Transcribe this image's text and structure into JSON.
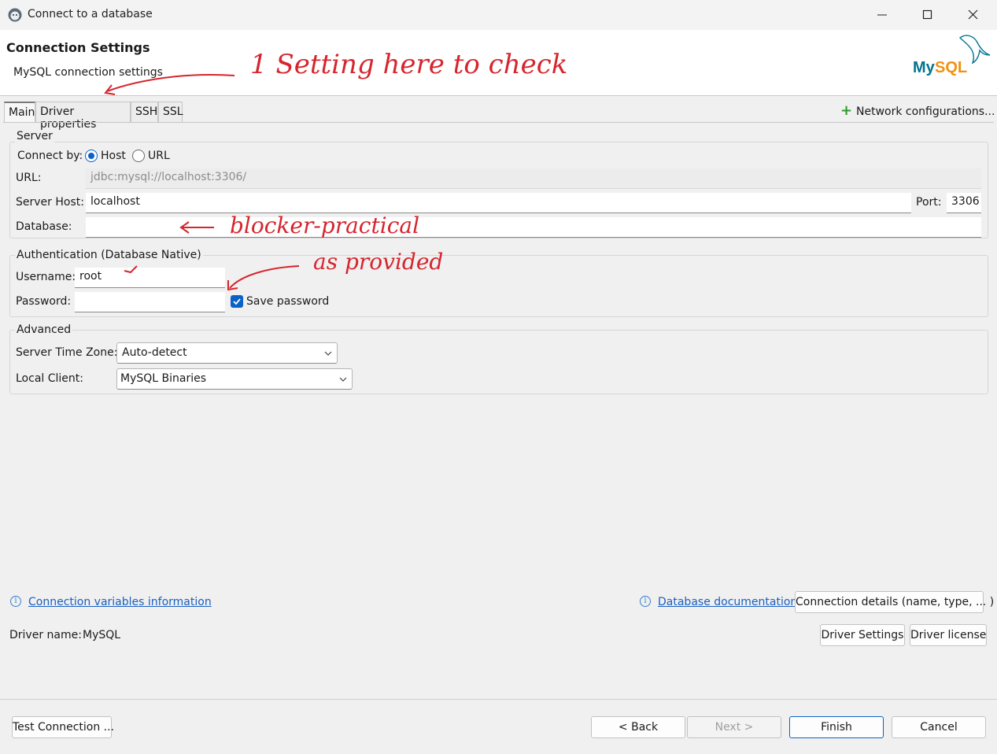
{
  "window": {
    "title": "Connect to a database"
  },
  "header": {
    "title": "Connection Settings",
    "subtitle": "MySQL connection settings",
    "logo_text": "MySQL"
  },
  "tabs": [
    {
      "label": "Main",
      "active": true
    },
    {
      "label": "Driver properties"
    },
    {
      "label": "SSH"
    },
    {
      "label": "SSL"
    }
  ],
  "network_config": {
    "label": "Network configurations..."
  },
  "server": {
    "group_label": "Server",
    "connect_by_label": "Connect by:",
    "connect_by_options": [
      "Host",
      "URL"
    ],
    "connect_by_selected": "Host",
    "url_label": "URL:",
    "url_value": "jdbc:mysql://localhost:3306/",
    "host_label": "Server Host:",
    "host_value": "localhost",
    "port_label": "Port:",
    "port_value": "3306",
    "database_label": "Database:",
    "database_value": ""
  },
  "auth": {
    "group_label": "Authentication (Database Native)",
    "username_label": "Username:",
    "username_value": "root",
    "password_label": "Password:",
    "password_value": "",
    "save_password_label": "Save password",
    "save_password_checked": true
  },
  "advanced": {
    "group_label": "Advanced",
    "timezone_label": "Server Time Zone:",
    "timezone_value": "Auto-detect",
    "local_client_label": "Local Client:",
    "local_client_value": "MySQL Binaries"
  },
  "links": {
    "conn_vars": "Connection variables information",
    "db_docs": "Database documentation"
  },
  "connection_details_button": "Connection details (name, type, ... )",
  "driver": {
    "name_label": "Driver name:",
    "name_value": "MySQL",
    "settings_button": "Driver Settings",
    "license_button": "Driver license"
  },
  "footer": {
    "test_button": "Test Connection ...",
    "back_button": "< Back",
    "next_button": "Next >",
    "finish_button": "Finish",
    "cancel_button": "Cancel"
  },
  "annotations": {
    "top": "1 Setting here to check",
    "database": "blocker-practical",
    "username": "as provided"
  },
  "colors": {
    "accent": "#0a62c7",
    "link": "#1a5fc0",
    "annotation": "#d6252e",
    "mysql_blue": "#00758f",
    "mysql_orange": "#f29111"
  }
}
